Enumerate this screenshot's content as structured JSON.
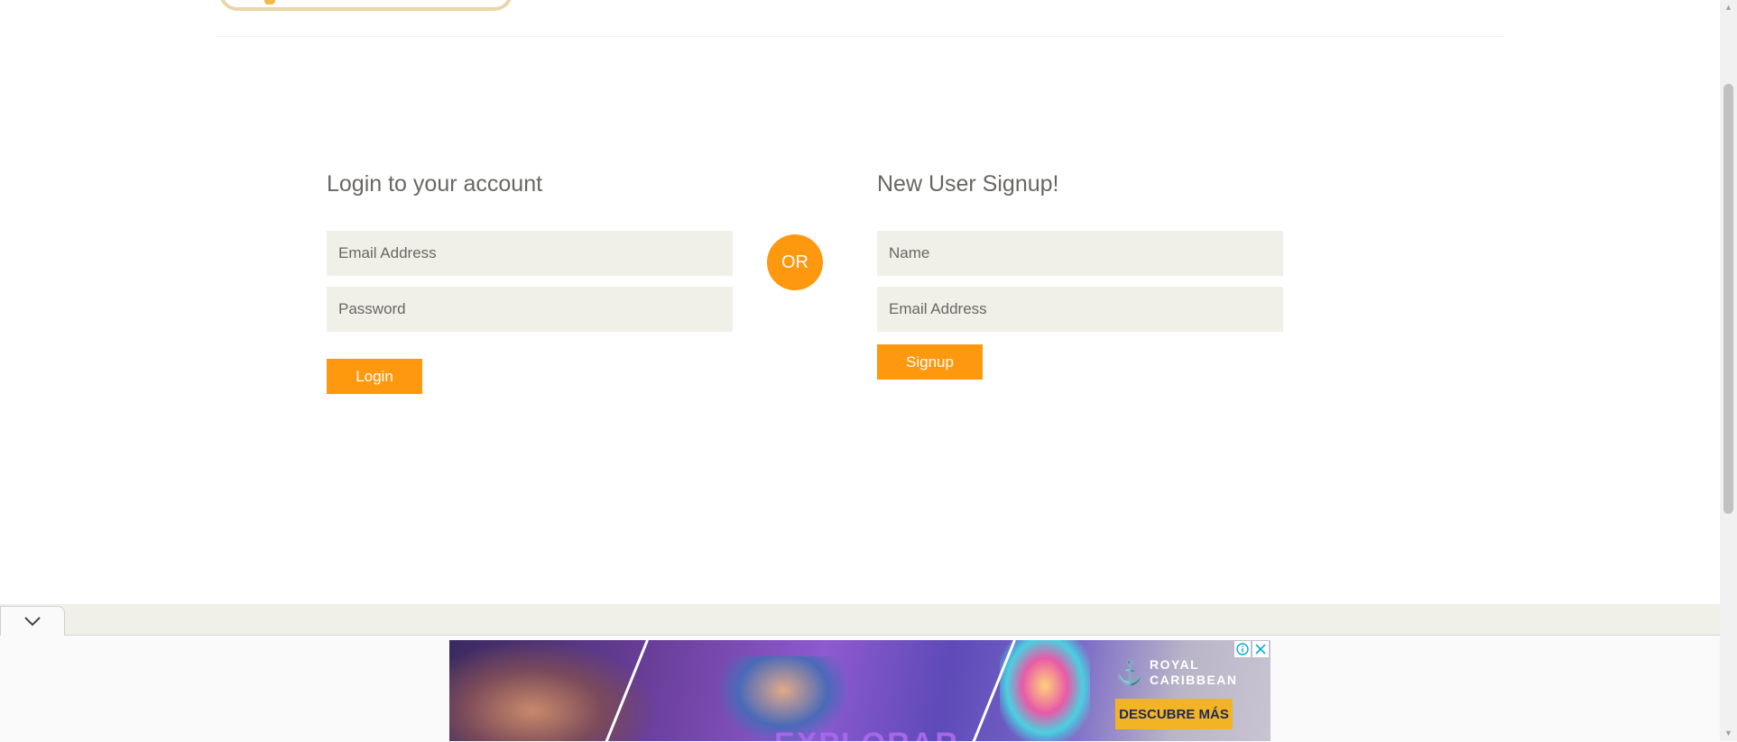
{
  "login": {
    "title": "Login to your account",
    "email_placeholder": "Email Address",
    "password_placeholder": "Password",
    "button_label": "Login"
  },
  "divider": {
    "label": "OR"
  },
  "signup": {
    "title": "New User Signup!",
    "name_placeholder": "Name",
    "email_placeholder": "Email Address",
    "button_label": "Signup"
  },
  "ad": {
    "brand_line1": "ROYAL",
    "brand_line2": "CARIBBEAN",
    "cta_label": "DESCUBRE MÁS",
    "headline": "EXPLORAR",
    "info_icon": "info-icon",
    "close_icon": "close-icon",
    "collapse_icon": "chevron-down-icon"
  },
  "colors": {
    "accent": "#fe980f",
    "field_bg": "#f0f0e9",
    "text": "#696763"
  }
}
